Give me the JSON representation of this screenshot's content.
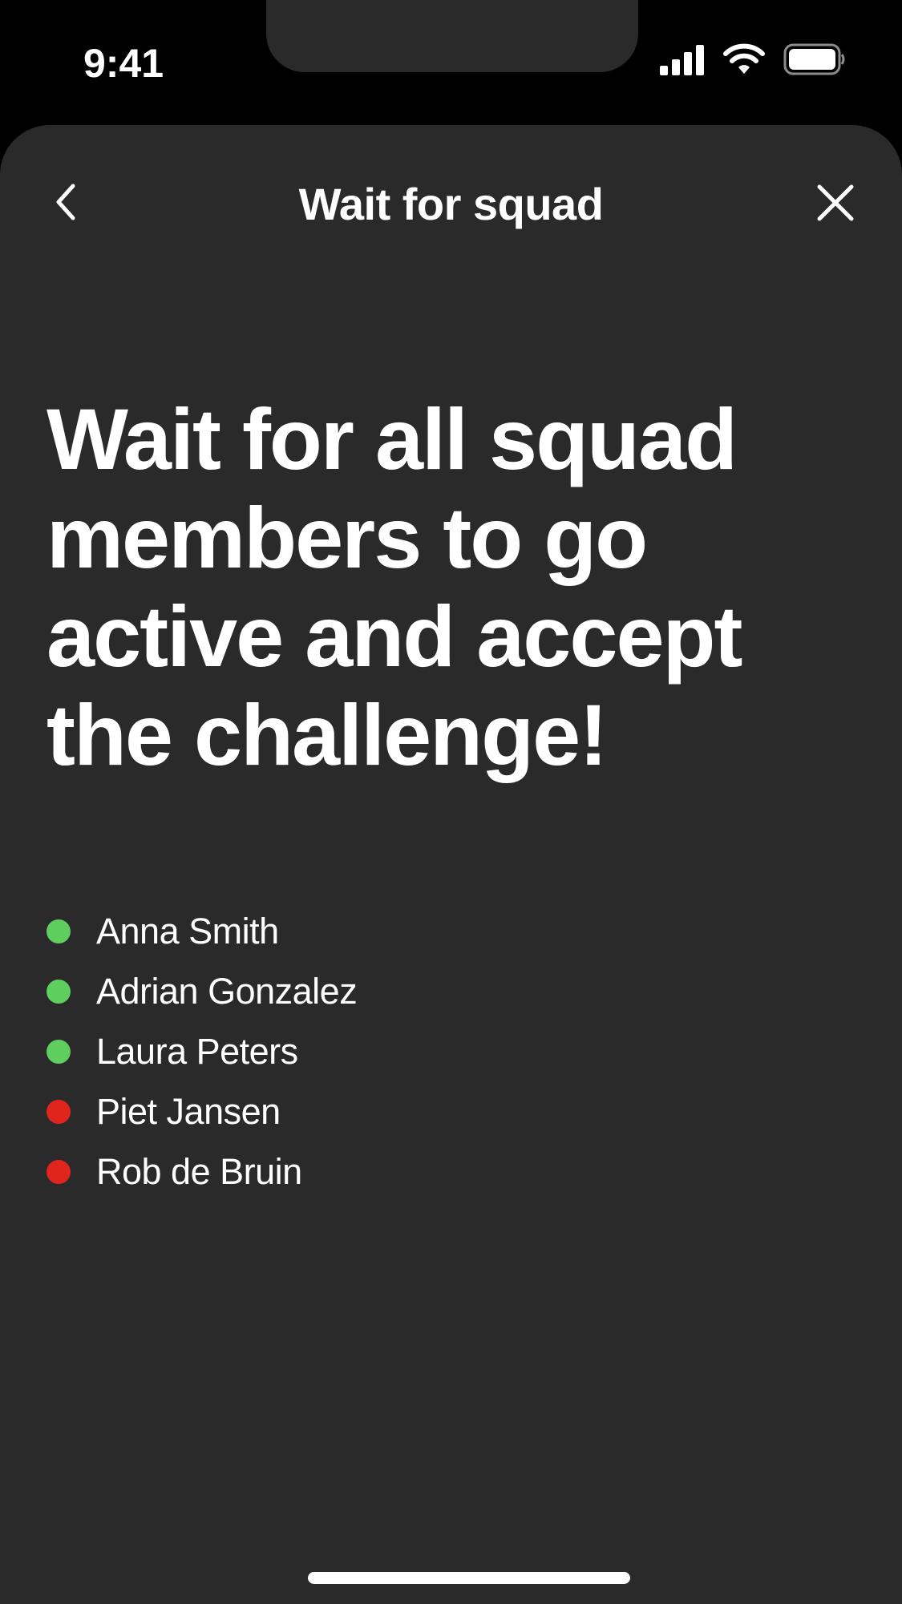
{
  "status_bar": {
    "time": "9:41",
    "icons": [
      "cellular-signal-icon",
      "wifi-icon",
      "battery-icon"
    ]
  },
  "nav": {
    "title": "Wait for squad",
    "back_icon": "chevron-left-icon",
    "close_icon": "close-icon"
  },
  "headline": "Wait for all squad members to go active and accept the challenge!",
  "members": [
    {
      "name": "Anna Smith",
      "status": "active",
      "color": "#5ecf5e"
    },
    {
      "name": "Adrian Gonzalez",
      "status": "active",
      "color": "#5ecf5e"
    },
    {
      "name": "Laura Peters",
      "status": "active",
      "color": "#5ecf5e"
    },
    {
      "name": "Piet Jansen",
      "status": "inactive",
      "color": "#e0261c"
    },
    {
      "name": "Rob de Bruin",
      "status": "inactive",
      "color": "#e0261c"
    }
  ],
  "colors": {
    "background": "#000000",
    "sheet": "#2a2a2a",
    "text": "#ffffff",
    "active": "#5ecf5e",
    "inactive": "#e0261c"
  }
}
